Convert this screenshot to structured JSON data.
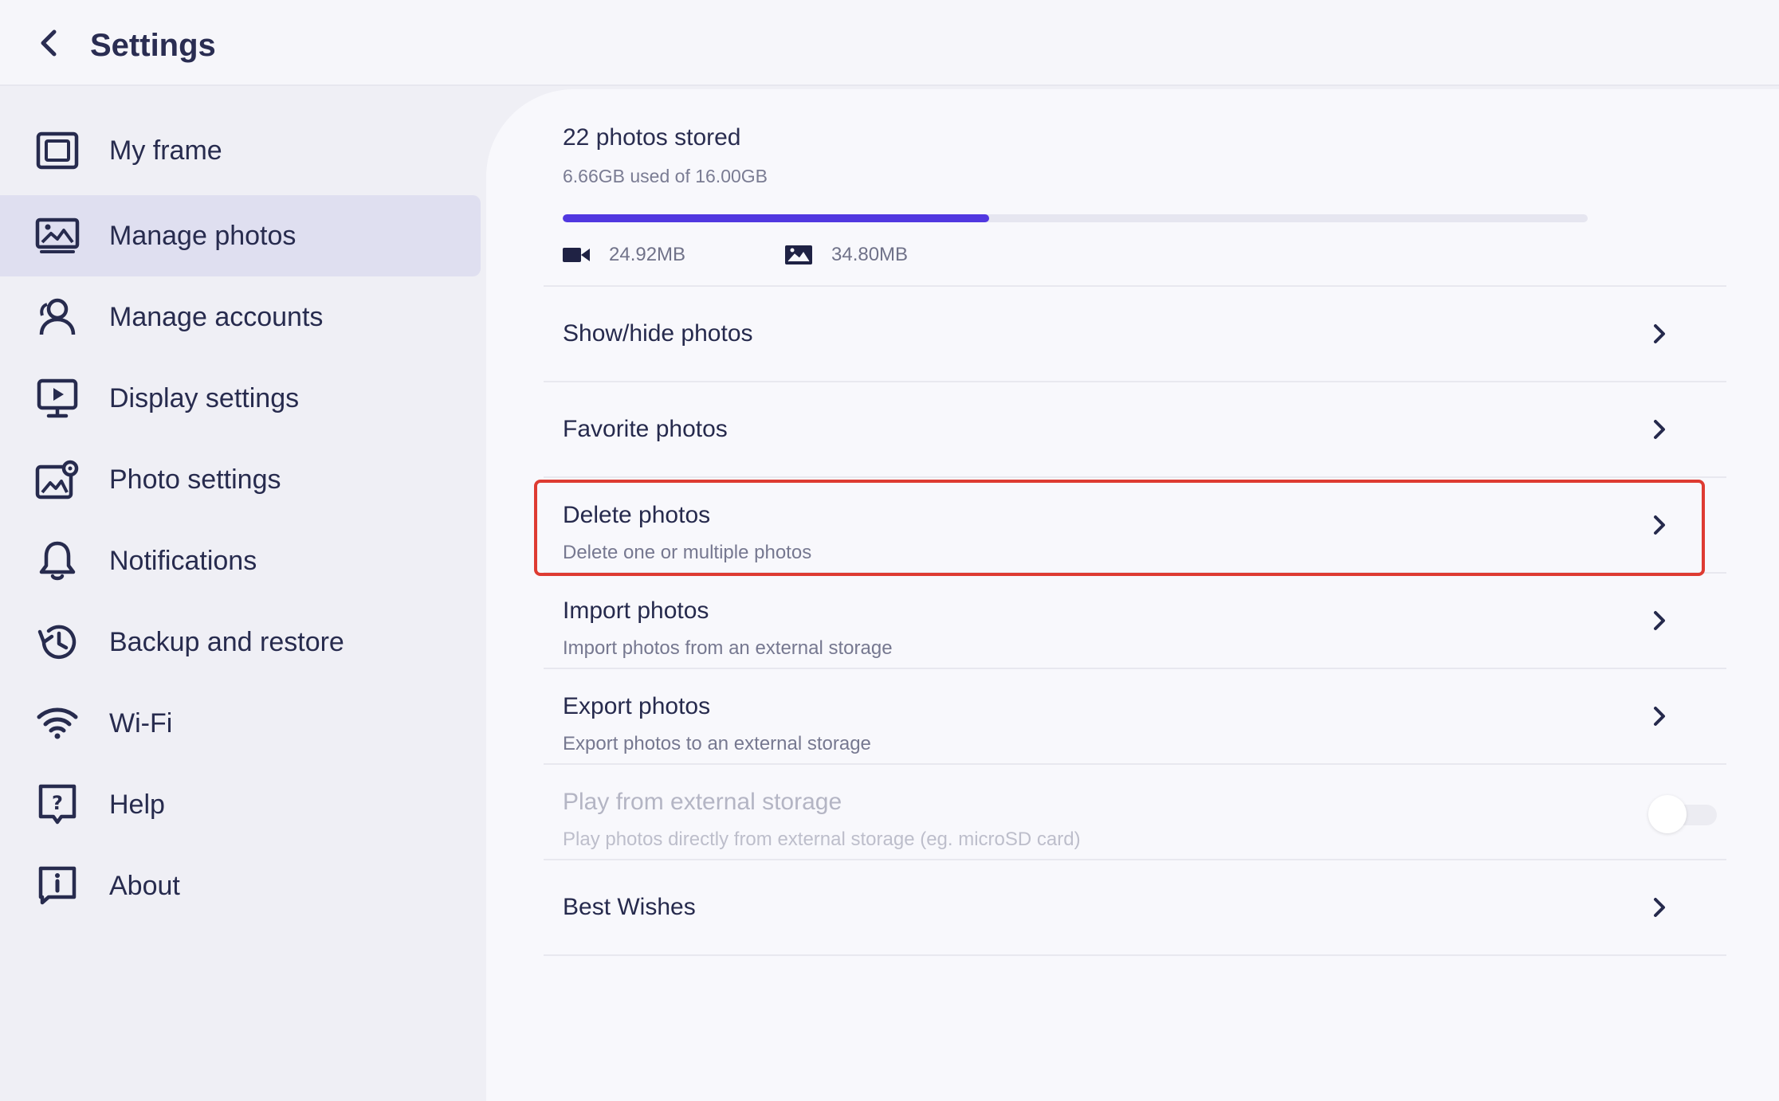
{
  "header": {
    "title": "Settings",
    "back_icon": "chevron-left-icon"
  },
  "sidebar": {
    "items": [
      {
        "label": "My frame",
        "icon": "frame-icon",
        "active": false
      },
      {
        "label": "Manage photos",
        "icon": "photos-icon",
        "active": true
      },
      {
        "label": "Manage accounts",
        "icon": "accounts-icon",
        "active": false
      },
      {
        "label": "Display settings",
        "icon": "display-icon",
        "active": false
      },
      {
        "label": "Photo settings",
        "icon": "photo-settings-icon",
        "active": false
      },
      {
        "label": "Notifications",
        "icon": "bell-icon",
        "active": false
      },
      {
        "label": "Backup and restore",
        "icon": "history-icon",
        "active": false
      },
      {
        "label": "Wi-Fi",
        "icon": "wifi-icon",
        "active": false
      },
      {
        "label": "Help",
        "icon": "help-icon",
        "active": false
      },
      {
        "label": "About",
        "icon": "info-icon",
        "active": false
      }
    ]
  },
  "storage": {
    "title": "22 photos stored",
    "usage": "6.66GB used of 16.00GB",
    "used_fraction": 0.416,
    "video_size": "24.92MB",
    "photo_size": "34.80MB"
  },
  "rows": [
    {
      "title": "Show/hide photos",
      "subtitle": ""
    },
    {
      "title": "Favorite photos",
      "subtitle": ""
    },
    {
      "title": "Delete photos",
      "subtitle": "Delete one or multiple photos"
    },
    {
      "title": "Import photos",
      "subtitle": "Import photos from an external storage"
    },
    {
      "title": "Export photos",
      "subtitle": "Export photos to an external storage"
    },
    {
      "title": "Play from external storage",
      "subtitle": "Play photos directly from external storage (eg. microSD card)",
      "toggle_on": false,
      "disabled": true
    },
    {
      "title": "Best Wishes",
      "subtitle": ""
    }
  ],
  "colors": {
    "accent": "#5138e0",
    "highlight": "#de3b32",
    "active_nav": "#dfdff0"
  }
}
